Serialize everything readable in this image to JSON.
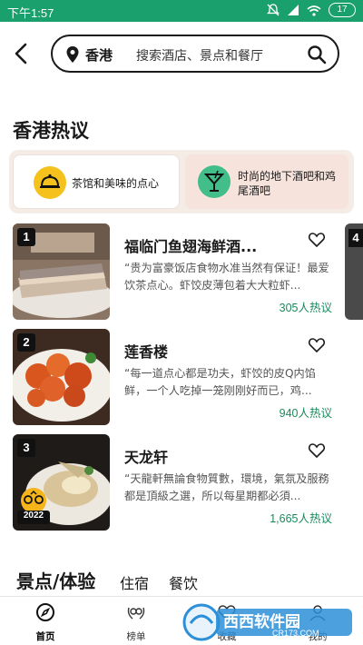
{
  "status_bar": {
    "time": "下午1:57",
    "battery": "17"
  },
  "search": {
    "city": "香港",
    "placeholder": "搜索酒店、景点和餐厅"
  },
  "section_title": "香港热议",
  "tabs": [
    {
      "label": "茶馆和美味的点心",
      "selected": true,
      "icon": "dim-sum-cloche-icon",
      "color": "#f4c11d"
    },
    {
      "label": "时尚的地下酒吧和鸡尾酒吧",
      "selected": false,
      "icon": "cocktail-icon",
      "color": "#41be8a"
    }
  ],
  "cards": [
    {
      "rank": "1",
      "name": "福临门鱼翅海鲜酒...",
      "quote": "“贵为富豪饭店食物水准当然有保证！最爱饮茶点心。虾饺皮薄包着大大粒虾...",
      "count": "305人热议"
    },
    {
      "rank": "2",
      "name": "莲香楼",
      "quote": "“每一道点心都是功夫，虾饺的皮Q内馅鲜，一个人吃掉一笼刚刚好而已，鸡...",
      "count": "940人热议"
    },
    {
      "rank": "3",
      "name": "天龙轩",
      "quote": "“天龍軒無論食物質數，環境，氣氛及服務都是頂級之選，所以每星期都必須...",
      "count": "1,665人热议",
      "award_year": "2022"
    }
  ],
  "peek_rank": "4",
  "section2": {
    "title": "景点/体验",
    "tabs": [
      "住宿",
      "餐饮"
    ]
  },
  "bottom_nav": [
    {
      "label": "首页",
      "icon": "compass-icon",
      "active": true
    },
    {
      "label": "榜单",
      "icon": "award-laurel-icon",
      "active": false
    },
    {
      "label": "收藏",
      "icon": "heart-icon",
      "active": false
    },
    {
      "label": "我的",
      "icon": "profile-icon",
      "active": false
    }
  ],
  "watermark": {
    "name": "西西软件园",
    "url": "CR173.COM"
  },
  "colors": {
    "brand_green": "#1aa06d",
    "count_green": "#1a8a5c",
    "tab_bg": "#f6ece6"
  }
}
